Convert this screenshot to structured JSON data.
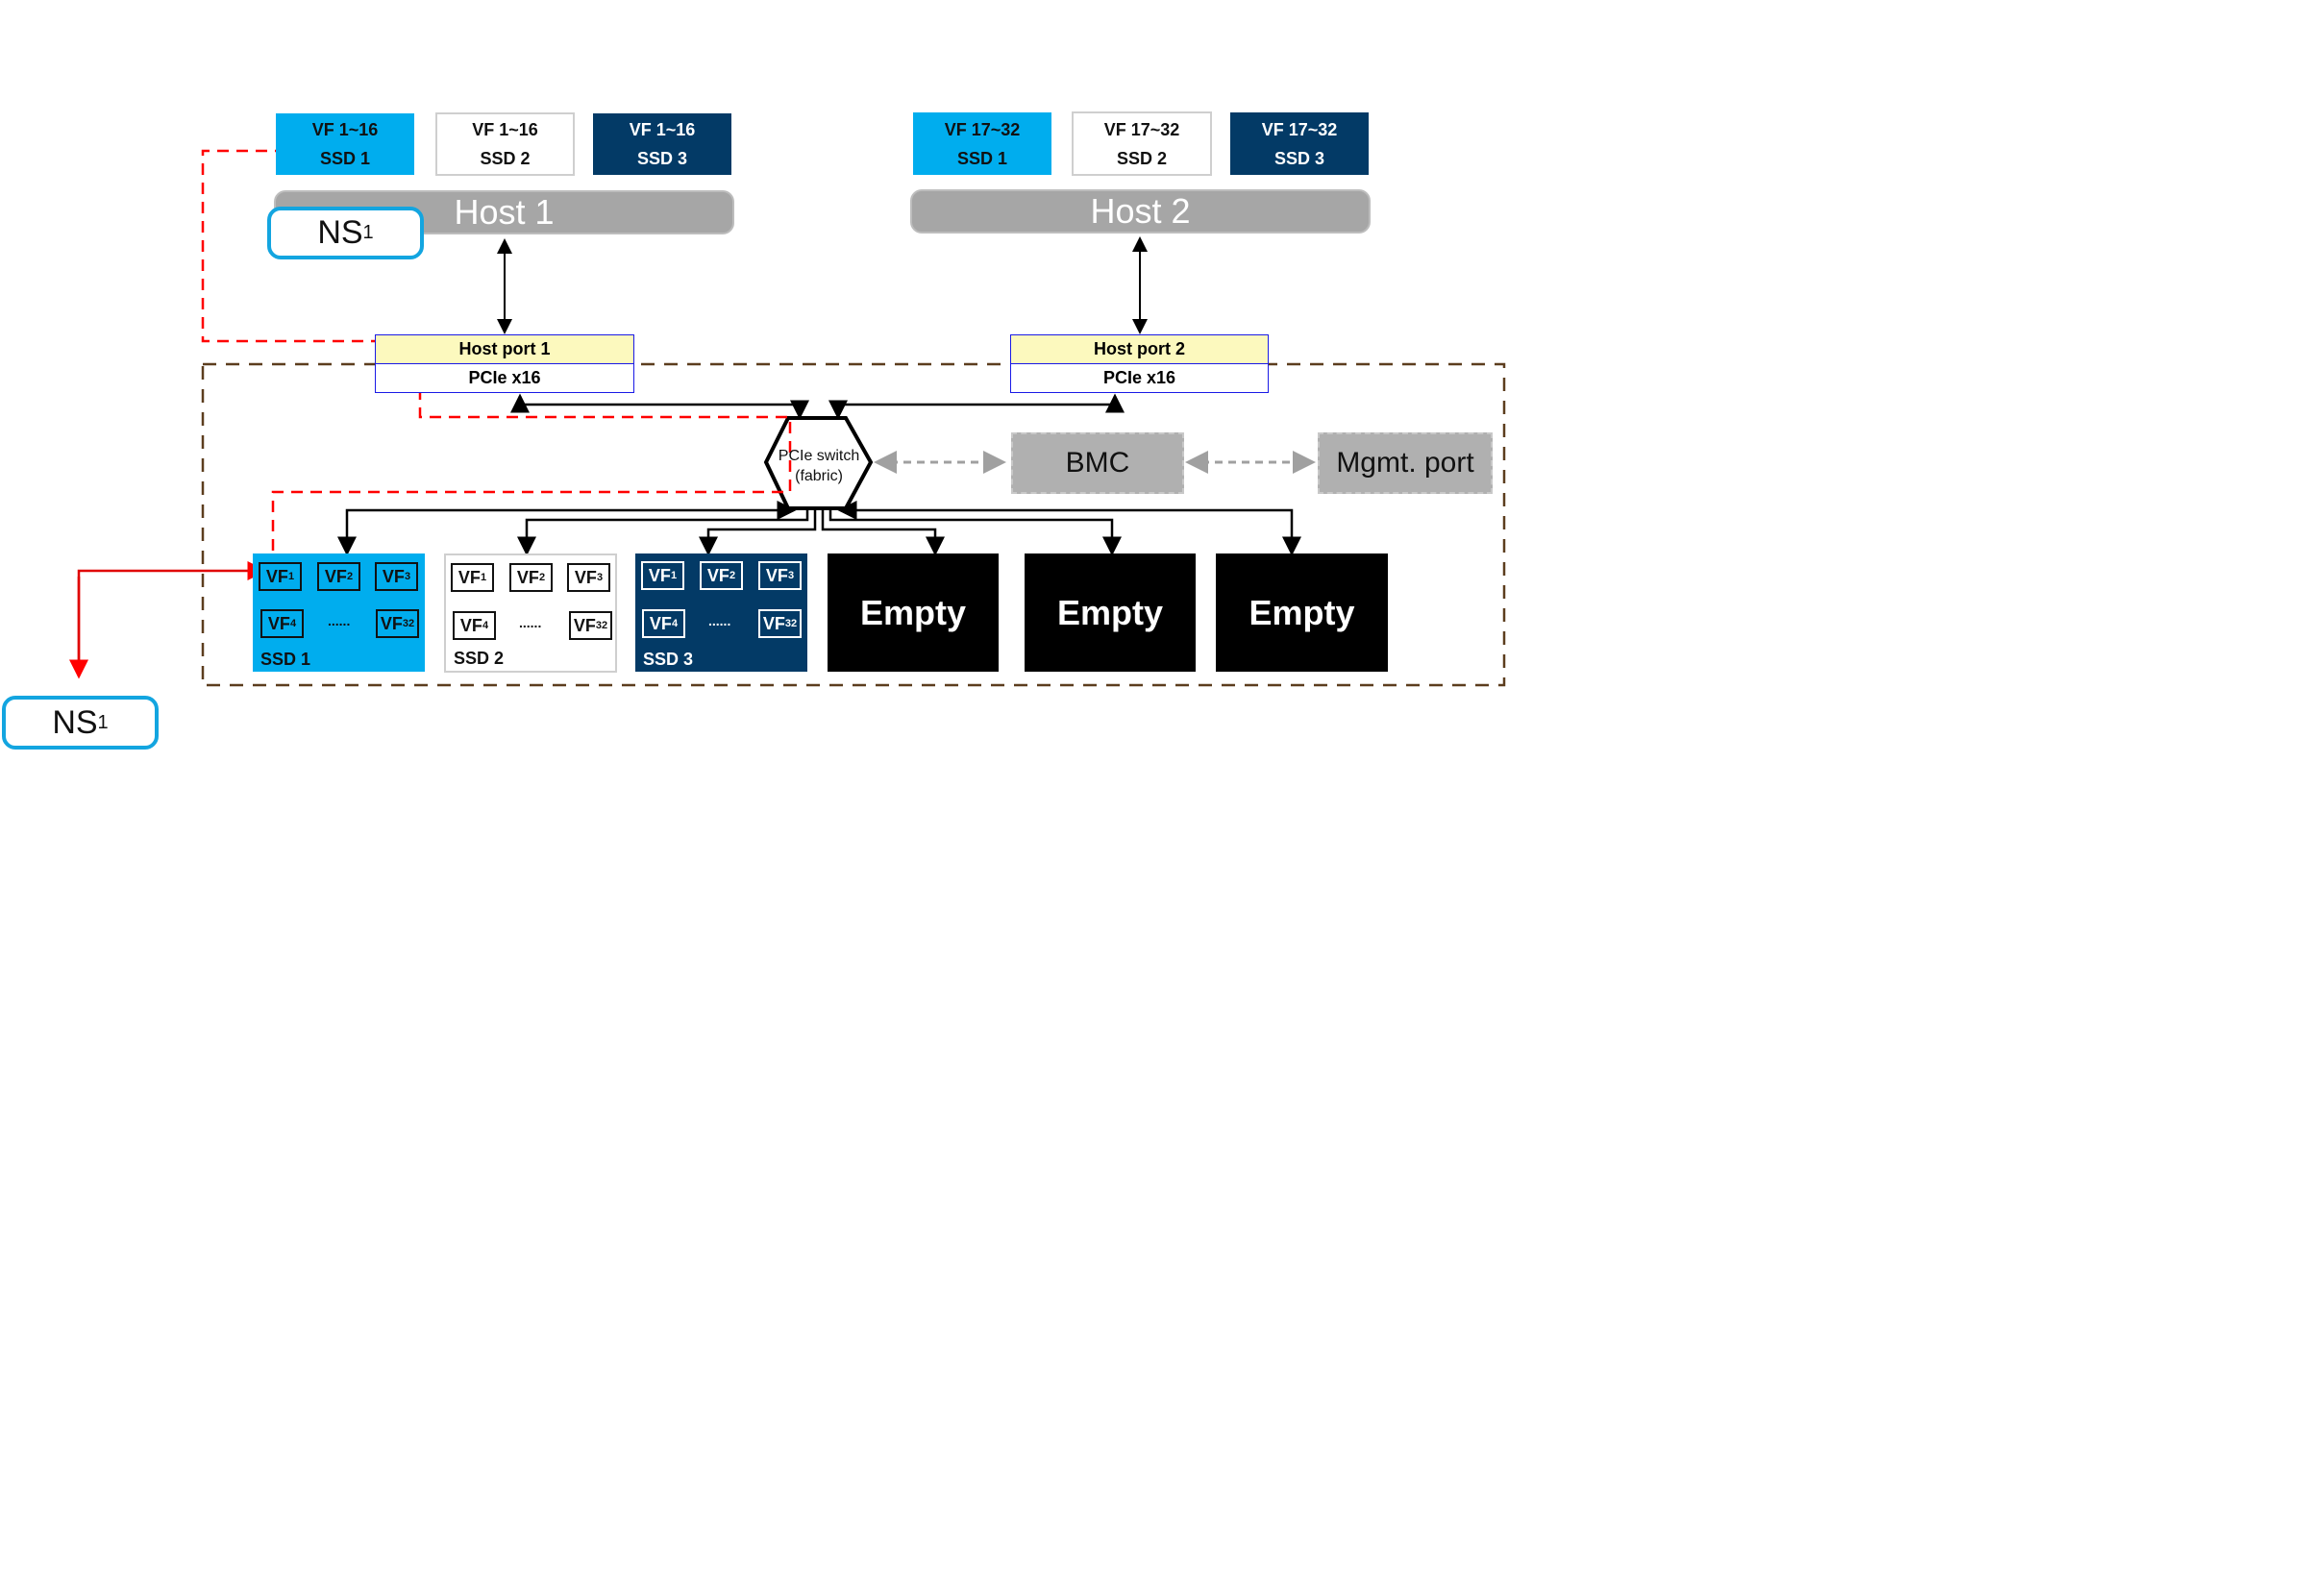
{
  "host1": {
    "label": "Host 1",
    "vf_groups": [
      {
        "vf": "VF 1~16",
        "ssd": "SSD 1",
        "color": "#00adee"
      },
      {
        "vf": "VF 1~16",
        "ssd": "SSD 2",
        "color": "#ffffff"
      },
      {
        "vf": "VF 1~16",
        "ssd": "SSD 3",
        "color": "#033a66"
      }
    ],
    "port": {
      "name": "Host port 1",
      "link": "PCIe x16"
    }
  },
  "host2": {
    "label": "Host 2",
    "vf_groups": [
      {
        "vf": "VF 17~32",
        "ssd": "SSD 1",
        "color": "#00adee"
      },
      {
        "vf": "VF 17~32",
        "ssd": "SSD 2",
        "color": "#ffffff"
      },
      {
        "vf": "VF 17~32",
        "ssd": "SSD 3",
        "color": "#033a66"
      }
    ],
    "port": {
      "name": "Host port 2",
      "link": "PCIe x16"
    }
  },
  "namespace_labels": {
    "ns": "NS",
    "sub": "1"
  },
  "switch": {
    "line1": "PCIe switch",
    "line2": "(fabric)"
  },
  "bmc": "BMC",
  "mgmt_port": "Mgmt. port",
  "ssds": [
    {
      "label": "SSD 1",
      "color": "#00adee",
      "vfs": [
        "1",
        "2",
        "3",
        "4",
        "32"
      ],
      "ellipsis": "......"
    },
    {
      "label": "SSD 2",
      "color": "#ffffff",
      "vfs": [
        "1",
        "2",
        "3",
        "4",
        "32"
      ],
      "ellipsis": "......"
    },
    {
      "label": "SSD 3",
      "color": "#033a66",
      "vfs": [
        "1",
        "2",
        "3",
        "4",
        "32"
      ],
      "ellipsis": "......"
    }
  ],
  "vf_prefix": "VF",
  "empty_slots": [
    "Empty",
    "Empty",
    "Empty"
  ],
  "colors": {
    "path_red": "#ff0000",
    "enclosure_brown": "#5c3d1e",
    "port_border": "#1a1ae6",
    "port_fill": "#fcf9be",
    "ns_border": "#13a5e0",
    "mgmt_gray": "#a0a0a0"
  }
}
